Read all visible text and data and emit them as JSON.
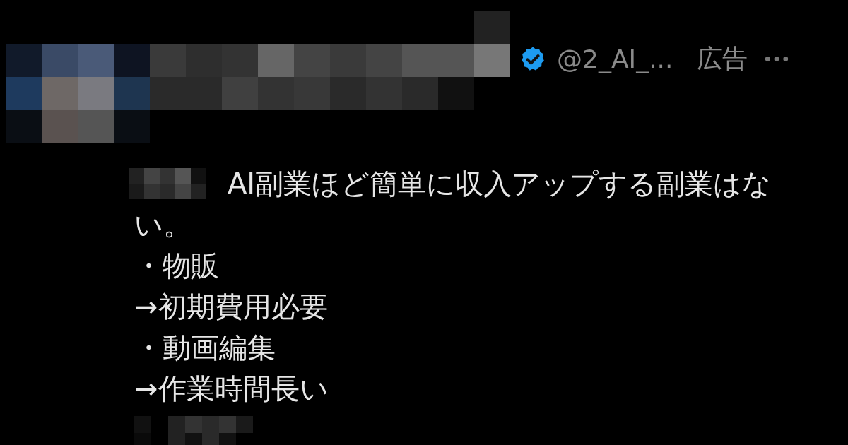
{
  "post": {
    "verified": true,
    "handle": "@2_AI_...",
    "ad_label": "広告",
    "body_lines": [
      "AI副業ほど簡単に収入アップする副業はな",
      "い。",
      "・物販",
      "→初期費用必要",
      "・動画編集",
      "→作業時間長い"
    ]
  }
}
